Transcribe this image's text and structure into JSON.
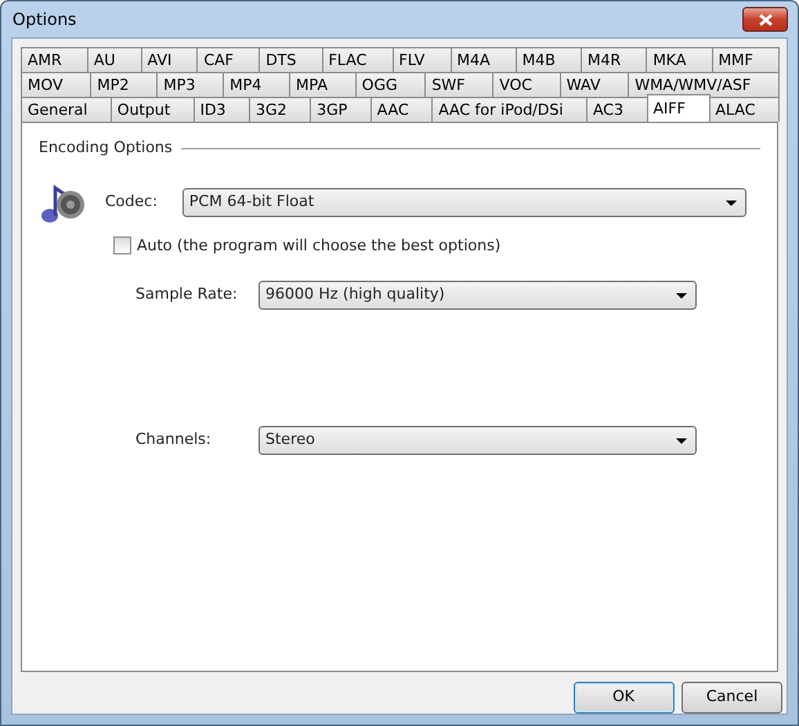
{
  "window": {
    "title": "Options"
  },
  "tab_rows": [
    [
      {
        "label": "AMR",
        "selected": false
      },
      {
        "label": "AU",
        "selected": false
      },
      {
        "label": "AVI",
        "selected": false
      },
      {
        "label": "CAF",
        "selected": false
      },
      {
        "label": "DTS",
        "selected": false
      },
      {
        "label": "FLAC",
        "selected": false
      },
      {
        "label": "FLV",
        "selected": false
      },
      {
        "label": "M4A",
        "selected": false
      },
      {
        "label": "M4B",
        "selected": false
      },
      {
        "label": "M4R",
        "selected": false
      },
      {
        "label": "MKA",
        "selected": false
      },
      {
        "label": "MMF",
        "selected": false
      }
    ],
    [
      {
        "label": "MOV",
        "selected": false
      },
      {
        "label": "MP2",
        "selected": false
      },
      {
        "label": "MP3",
        "selected": false
      },
      {
        "label": "MP4",
        "selected": false
      },
      {
        "label": "MPA",
        "selected": false
      },
      {
        "label": "OGG",
        "selected": false
      },
      {
        "label": "SWF",
        "selected": false
      },
      {
        "label": "VOC",
        "selected": false
      },
      {
        "label": "WAV",
        "selected": false
      },
      {
        "label": "WMA/WMV/ASF",
        "selected": false
      }
    ],
    [
      {
        "label": "General",
        "selected": false
      },
      {
        "label": "Output",
        "selected": false
      },
      {
        "label": "ID3",
        "selected": false
      },
      {
        "label": "3G2",
        "selected": false
      },
      {
        "label": "3GP",
        "selected": false
      },
      {
        "label": "AAC",
        "selected": false
      },
      {
        "label": "AAC for iPod/DSi",
        "selected": false
      },
      {
        "label": "AC3",
        "selected": false
      },
      {
        "label": "AIFF",
        "selected": true
      },
      {
        "label": "ALAC",
        "selected": false
      }
    ]
  ],
  "group": {
    "title": "Encoding Options"
  },
  "codec": {
    "label": "Codec:",
    "value": "PCM 64-bit Float"
  },
  "auto": {
    "label": "Auto (the program will choose the best options)",
    "checked": false
  },
  "sample_rate": {
    "label": "Sample Rate:",
    "value": "96000 Hz (high quality)"
  },
  "channels": {
    "label": "Channels:",
    "value": "Stereo"
  },
  "buttons": [
    {
      "label": "OK",
      "default": true
    },
    {
      "label": "Cancel",
      "default": false
    }
  ]
}
